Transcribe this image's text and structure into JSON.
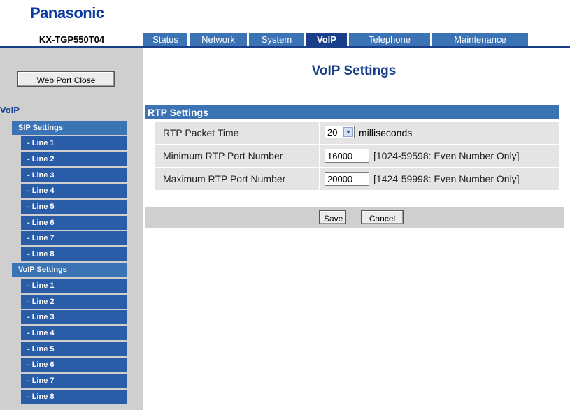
{
  "brand": {
    "logo": "Panasonic"
  },
  "device": {
    "model": "KX-TGP550T04"
  },
  "tabs": [
    {
      "label": "Status",
      "active": false
    },
    {
      "label": "Network",
      "active": false
    },
    {
      "label": "System",
      "active": false
    },
    {
      "label": "VoIP",
      "active": true
    },
    {
      "label": "Telephone",
      "active": false
    },
    {
      "label": "Maintenance",
      "active": false
    }
  ],
  "sidebar": {
    "web_port_close": "Web Port Close",
    "section_title": "VoIP",
    "groups": [
      {
        "label": "SIP Settings",
        "items": [
          "- Line 1",
          "- Line 2",
          "- Line 3",
          "- Line 4",
          "- Line 5",
          "- Line 6",
          "- Line 7",
          "- Line 8"
        ]
      },
      {
        "label": "VoIP Settings",
        "items": [
          "- Line 1",
          "- Line 2",
          "- Line 3",
          "- Line 4",
          "- Line 5",
          "- Line 6",
          "- Line 7",
          "- Line 8"
        ]
      }
    ]
  },
  "page": {
    "title": "VoIP Settings",
    "section_title": "RTP Settings",
    "rows": [
      {
        "label": "RTP Packet Time",
        "value": "20",
        "unit": "milliseconds"
      },
      {
        "label": "Minimum RTP Port Number",
        "value": "16000",
        "hint": "[1024-59598: Even Number Only]"
      },
      {
        "label": "Maximum RTP Port Number",
        "value": "20000",
        "hint": "[1424-59998: Even Number Only]"
      }
    ],
    "save_label": "Save",
    "cancel_label": "Cancel"
  },
  "colors": {
    "brand_blue": "#0b3aa1",
    "tab_blue": "#3b73b4",
    "tab_active": "#1a3f8a",
    "nav_blue": "#2a5da8"
  }
}
